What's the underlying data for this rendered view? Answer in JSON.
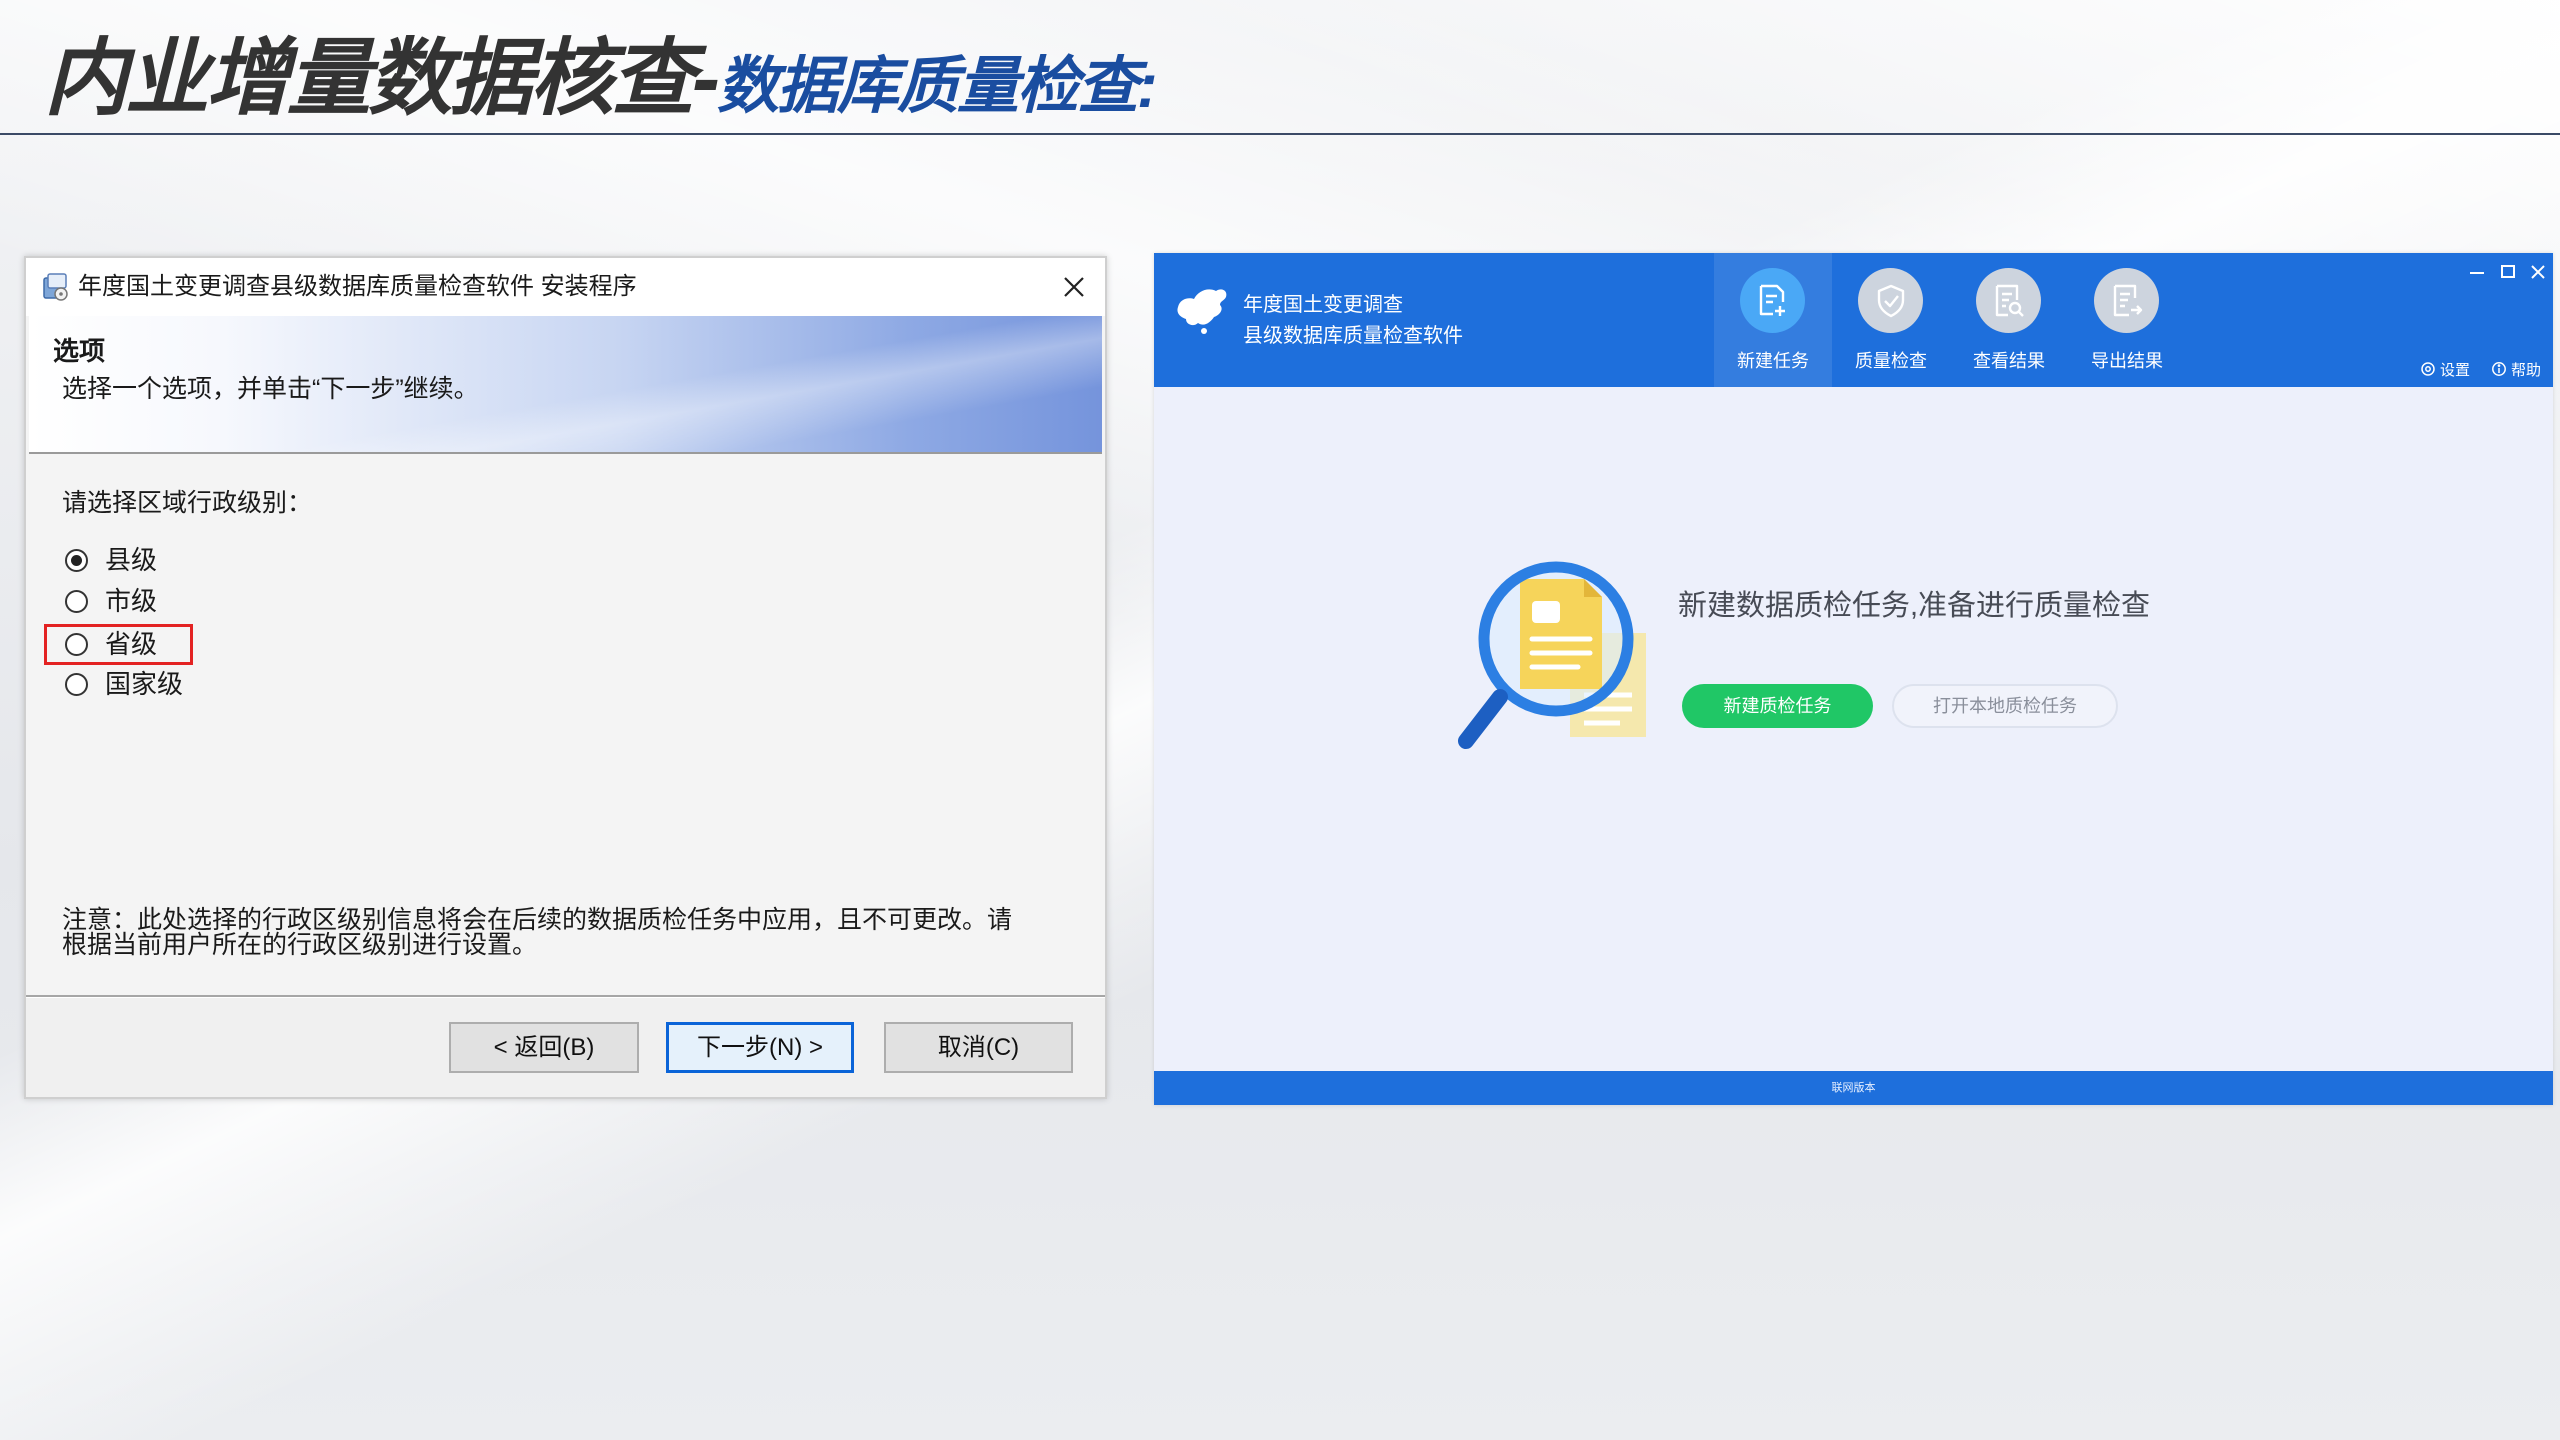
{
  "slide": {
    "title_main": "内业增量数据核查-",
    "title_sub": "数据库质量检查:"
  },
  "installer": {
    "window_title": "年度国土变更调查县级数据库质量检查软件 安装程序",
    "header_title": "选项",
    "header_subtitle": "选择一个选项，并单击“下一步”继续。",
    "prompt": "请选择区域行政级别：",
    "options": [
      {
        "label": "县级",
        "selected": true,
        "highlighted": false
      },
      {
        "label": "市级",
        "selected": false,
        "highlighted": false
      },
      {
        "label": "省级",
        "selected": false,
        "highlighted": true
      },
      {
        "label": "国家级",
        "selected": false,
        "highlighted": false
      }
    ],
    "note_lines": [
      "注意：此处选择的行政区级别信息将会在后续的数据质检任务中应用，且不可更改。请",
      "根据当前用户所在的行政区级别进行设置。"
    ],
    "buttons": {
      "back": "< 返回(B)",
      "next": "下一步(N) >",
      "cancel": "取消(C)"
    }
  },
  "app": {
    "title_line1": "年度国土变更调查",
    "title_line2": "县级数据库质量检查软件",
    "nav": [
      {
        "label": "新建任务",
        "icon": "new-task-icon",
        "active": true
      },
      {
        "label": "质量检查",
        "icon": "shield-check-icon",
        "active": false
      },
      {
        "label": "查看结果",
        "icon": "view-results-icon",
        "active": false
      },
      {
        "label": "导出结果",
        "icon": "export-results-icon",
        "active": false
      }
    ],
    "settings_label": "设置",
    "help_label": "帮助",
    "empty_state": {
      "message": "新建数据质检任务,准备进行质量检查",
      "primary_button": "新建质检任务",
      "secondary_button": "打开本地质检任务"
    },
    "footer_text": "联网版本"
  },
  "colors": {
    "accent": "#1e6fdc",
    "green": "#20c766",
    "highlight": "#e32222",
    "title_blue": "#1a4da0",
    "title_dark": "#333333",
    "app_bg": "#edf0fb"
  }
}
